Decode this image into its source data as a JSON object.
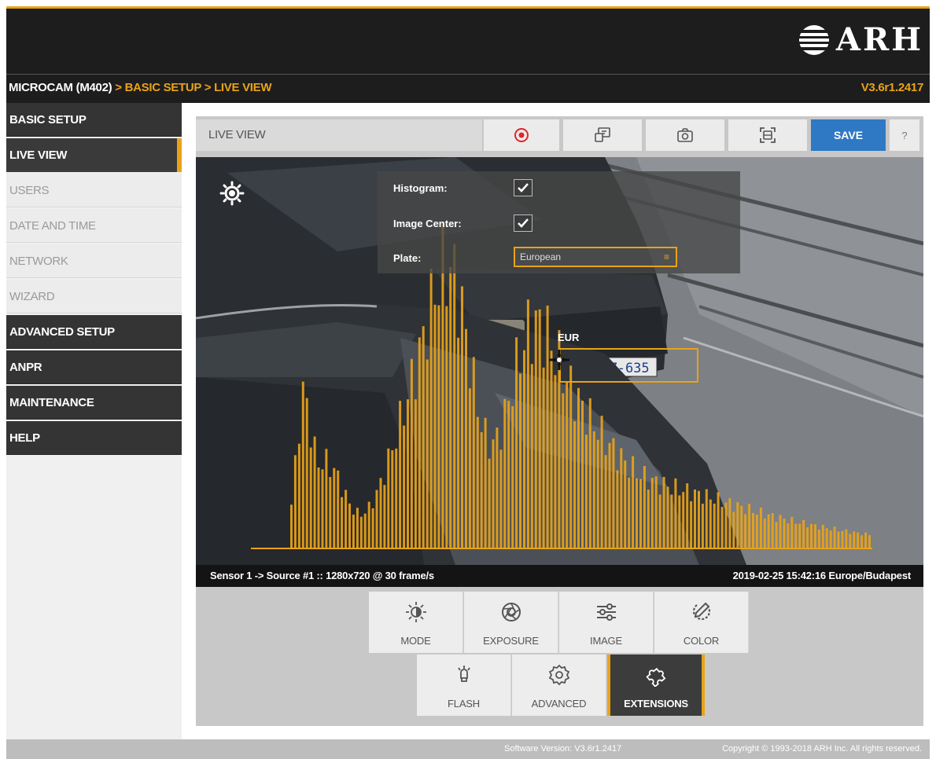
{
  "header": {
    "logo_text": "ARH",
    "breadcrumb": [
      "MICROCAM (M402)",
      "BASIC SETUP",
      "LIVE VIEW"
    ],
    "breadcrumb_sep": ">",
    "version": "V3.6r1.2417",
    "accent_color": "#e8a31a"
  },
  "sidebar": {
    "sections": [
      {
        "label": "BASIC SETUP",
        "items": [
          {
            "label": "LIVE VIEW",
            "active": true
          },
          {
            "label": "USERS"
          },
          {
            "label": "DATE AND TIME"
          },
          {
            "label": "NETWORK"
          },
          {
            "label": "WIZARD"
          }
        ]
      },
      {
        "label": "ADVANCED SETUP"
      },
      {
        "label": "ANPR"
      },
      {
        "label": "MAINTENANCE"
      },
      {
        "label": "HELP"
      }
    ]
  },
  "toolbar": {
    "title": "LIVE VIEW",
    "buttons": [
      {
        "icon": "record-icon"
      },
      {
        "icon": "screen-capture-icon"
      },
      {
        "icon": "camera-icon"
      },
      {
        "icon": "focus-frame-icon"
      }
    ],
    "save_label": "SAVE",
    "help_label": "?"
  },
  "overlay": {
    "histogram_label": "Histogram:",
    "histogram_checked": true,
    "image_center_label": "Image Center:",
    "image_center_checked": true,
    "plate_label": "Plate:",
    "plate_value": "European"
  },
  "video": {
    "plate_region": "EUR",
    "plate_text": "RHZ-635",
    "status_left": "Sensor 1 -> Source #1 :: 1280x720 @ 30 frame/s",
    "status_right": "2019-02-25 15:42:16 Europe/Budapest"
  },
  "tools": {
    "row1": [
      {
        "label": "MODE",
        "icon": "brightness-icon"
      },
      {
        "label": "EXPOSURE",
        "icon": "aperture-icon"
      },
      {
        "label": "IMAGE",
        "icon": "sliders-icon"
      },
      {
        "label": "COLOR",
        "icon": "color-icon"
      }
    ],
    "row2": [
      {
        "label": "FLASH",
        "icon": "flash-bulb-icon"
      },
      {
        "label": "ADVANCED",
        "icon": "advanced-gear-icon"
      },
      {
        "label": "EXTENSIONS",
        "icon": "puzzle-icon",
        "active": true
      }
    ]
  },
  "footer": {
    "version_text": "Software Version: V3.6r1.2417",
    "copyright": "Copyright © 1993-2018 ARH Inc. All rights reserved."
  }
}
